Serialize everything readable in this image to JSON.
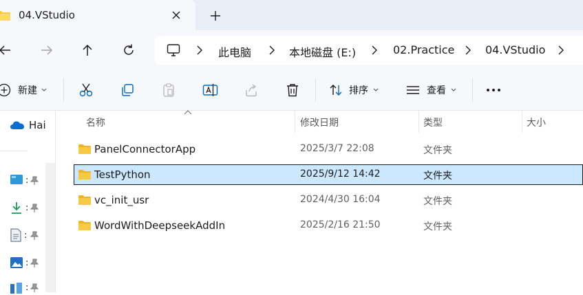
{
  "window": {
    "tab_title": "04.VStudio",
    "icons": {
      "tab": "folder-icon",
      "close": "close-icon",
      "new_tab": "plus-icon"
    }
  },
  "navigation": {
    "buttons": [
      "back-arrow-icon",
      "forward-arrow-icon",
      "up-arrow-icon",
      "refresh-icon"
    ],
    "breadcrumbs": [
      "此电脑",
      "本地磁盘 (E:)",
      "02.Practice",
      "04.VStudio"
    ]
  },
  "toolbar": {
    "new_label": "新建",
    "sort_label": "排序",
    "view_label": "查看",
    "icons": [
      "cut-icon",
      "copy-icon",
      "paste-icon",
      "rename-icon",
      "share-icon",
      "delete-icon",
      "more-icon"
    ]
  },
  "sidebar": {
    "top_item": "Hai",
    "items": [
      {
        "icon": "desktop-icon",
        "label": ":"
      },
      {
        "icon": "download-icon",
        "label": ":"
      },
      {
        "icon": "document-icon",
        "label": ":"
      },
      {
        "icon": "picture-icon",
        "label": ":"
      },
      {
        "icon": "music-icon",
        "label": ":"
      }
    ]
  },
  "file_list": {
    "columns": [
      "名称",
      "修改日期",
      "类型",
      "大小"
    ],
    "rows": [
      {
        "name": "PanelConnectorApp",
        "modified": "2025/3/7 22:08",
        "type": "文件夹",
        "selected": false
      },
      {
        "name": "TestPython",
        "modified": "2025/9/12 14:42",
        "type": "文件夹",
        "selected": true
      },
      {
        "name": "vc_init_usr",
        "modified": "2024/4/30 16:04",
        "type": "文件夹",
        "selected": false
      },
      {
        "name": "WordWithDeepseekAddIn",
        "modified": "2025/2/16 21:50",
        "type": "文件夹",
        "selected": false
      }
    ]
  },
  "colors": {
    "selection": "#cce8ff",
    "folder": "#f8c945",
    "chrome": "#f6f8fc",
    "tabstrip": "#e9eef6",
    "accent": "#0067c0"
  }
}
